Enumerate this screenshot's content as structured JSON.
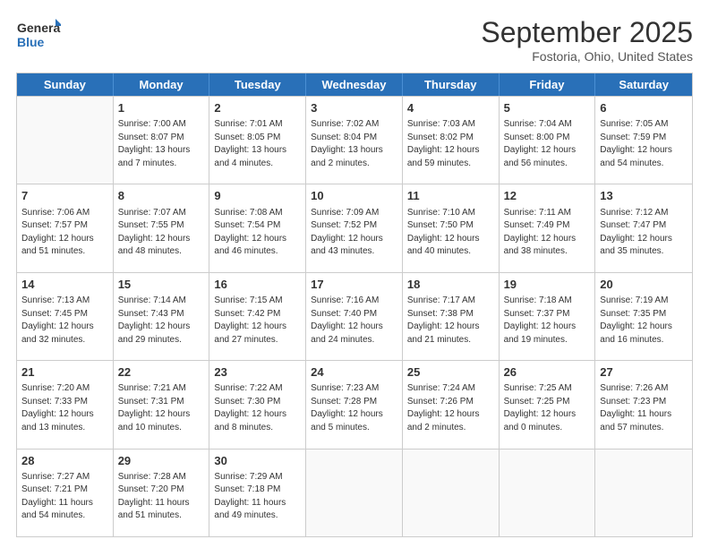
{
  "logo": {
    "line1": "General",
    "line2": "Blue"
  },
  "title": "September 2025",
  "subtitle": "Fostoria, Ohio, United States",
  "dayHeaders": [
    "Sunday",
    "Monday",
    "Tuesday",
    "Wednesday",
    "Thursday",
    "Friday",
    "Saturday"
  ],
  "weeks": [
    [
      {
        "num": "",
        "info": ""
      },
      {
        "num": "1",
        "info": "Sunrise: 7:00 AM\nSunset: 8:07 PM\nDaylight: 13 hours\nand 7 minutes."
      },
      {
        "num": "2",
        "info": "Sunrise: 7:01 AM\nSunset: 8:05 PM\nDaylight: 13 hours\nand 4 minutes."
      },
      {
        "num": "3",
        "info": "Sunrise: 7:02 AM\nSunset: 8:04 PM\nDaylight: 13 hours\nand 2 minutes."
      },
      {
        "num": "4",
        "info": "Sunrise: 7:03 AM\nSunset: 8:02 PM\nDaylight: 12 hours\nand 59 minutes."
      },
      {
        "num": "5",
        "info": "Sunrise: 7:04 AM\nSunset: 8:00 PM\nDaylight: 12 hours\nand 56 minutes."
      },
      {
        "num": "6",
        "info": "Sunrise: 7:05 AM\nSunset: 7:59 PM\nDaylight: 12 hours\nand 54 minutes."
      }
    ],
    [
      {
        "num": "7",
        "info": "Sunrise: 7:06 AM\nSunset: 7:57 PM\nDaylight: 12 hours\nand 51 minutes."
      },
      {
        "num": "8",
        "info": "Sunrise: 7:07 AM\nSunset: 7:55 PM\nDaylight: 12 hours\nand 48 minutes."
      },
      {
        "num": "9",
        "info": "Sunrise: 7:08 AM\nSunset: 7:54 PM\nDaylight: 12 hours\nand 46 minutes."
      },
      {
        "num": "10",
        "info": "Sunrise: 7:09 AM\nSunset: 7:52 PM\nDaylight: 12 hours\nand 43 minutes."
      },
      {
        "num": "11",
        "info": "Sunrise: 7:10 AM\nSunset: 7:50 PM\nDaylight: 12 hours\nand 40 minutes."
      },
      {
        "num": "12",
        "info": "Sunrise: 7:11 AM\nSunset: 7:49 PM\nDaylight: 12 hours\nand 38 minutes."
      },
      {
        "num": "13",
        "info": "Sunrise: 7:12 AM\nSunset: 7:47 PM\nDaylight: 12 hours\nand 35 minutes."
      }
    ],
    [
      {
        "num": "14",
        "info": "Sunrise: 7:13 AM\nSunset: 7:45 PM\nDaylight: 12 hours\nand 32 minutes."
      },
      {
        "num": "15",
        "info": "Sunrise: 7:14 AM\nSunset: 7:43 PM\nDaylight: 12 hours\nand 29 minutes."
      },
      {
        "num": "16",
        "info": "Sunrise: 7:15 AM\nSunset: 7:42 PM\nDaylight: 12 hours\nand 27 minutes."
      },
      {
        "num": "17",
        "info": "Sunrise: 7:16 AM\nSunset: 7:40 PM\nDaylight: 12 hours\nand 24 minutes."
      },
      {
        "num": "18",
        "info": "Sunrise: 7:17 AM\nSunset: 7:38 PM\nDaylight: 12 hours\nand 21 minutes."
      },
      {
        "num": "19",
        "info": "Sunrise: 7:18 AM\nSunset: 7:37 PM\nDaylight: 12 hours\nand 19 minutes."
      },
      {
        "num": "20",
        "info": "Sunrise: 7:19 AM\nSunset: 7:35 PM\nDaylight: 12 hours\nand 16 minutes."
      }
    ],
    [
      {
        "num": "21",
        "info": "Sunrise: 7:20 AM\nSunset: 7:33 PM\nDaylight: 12 hours\nand 13 minutes."
      },
      {
        "num": "22",
        "info": "Sunrise: 7:21 AM\nSunset: 7:31 PM\nDaylight: 12 hours\nand 10 minutes."
      },
      {
        "num": "23",
        "info": "Sunrise: 7:22 AM\nSunset: 7:30 PM\nDaylight: 12 hours\nand 8 minutes."
      },
      {
        "num": "24",
        "info": "Sunrise: 7:23 AM\nSunset: 7:28 PM\nDaylight: 12 hours\nand 5 minutes."
      },
      {
        "num": "25",
        "info": "Sunrise: 7:24 AM\nSunset: 7:26 PM\nDaylight: 12 hours\nand 2 minutes."
      },
      {
        "num": "26",
        "info": "Sunrise: 7:25 AM\nSunset: 7:25 PM\nDaylight: 12 hours\nand 0 minutes."
      },
      {
        "num": "27",
        "info": "Sunrise: 7:26 AM\nSunset: 7:23 PM\nDaylight: 11 hours\nand 57 minutes."
      }
    ],
    [
      {
        "num": "28",
        "info": "Sunrise: 7:27 AM\nSunset: 7:21 PM\nDaylight: 11 hours\nand 54 minutes."
      },
      {
        "num": "29",
        "info": "Sunrise: 7:28 AM\nSunset: 7:20 PM\nDaylight: 11 hours\nand 51 minutes."
      },
      {
        "num": "30",
        "info": "Sunrise: 7:29 AM\nSunset: 7:18 PM\nDaylight: 11 hours\nand 49 minutes."
      },
      {
        "num": "",
        "info": ""
      },
      {
        "num": "",
        "info": ""
      },
      {
        "num": "",
        "info": ""
      },
      {
        "num": "",
        "info": ""
      }
    ]
  ]
}
